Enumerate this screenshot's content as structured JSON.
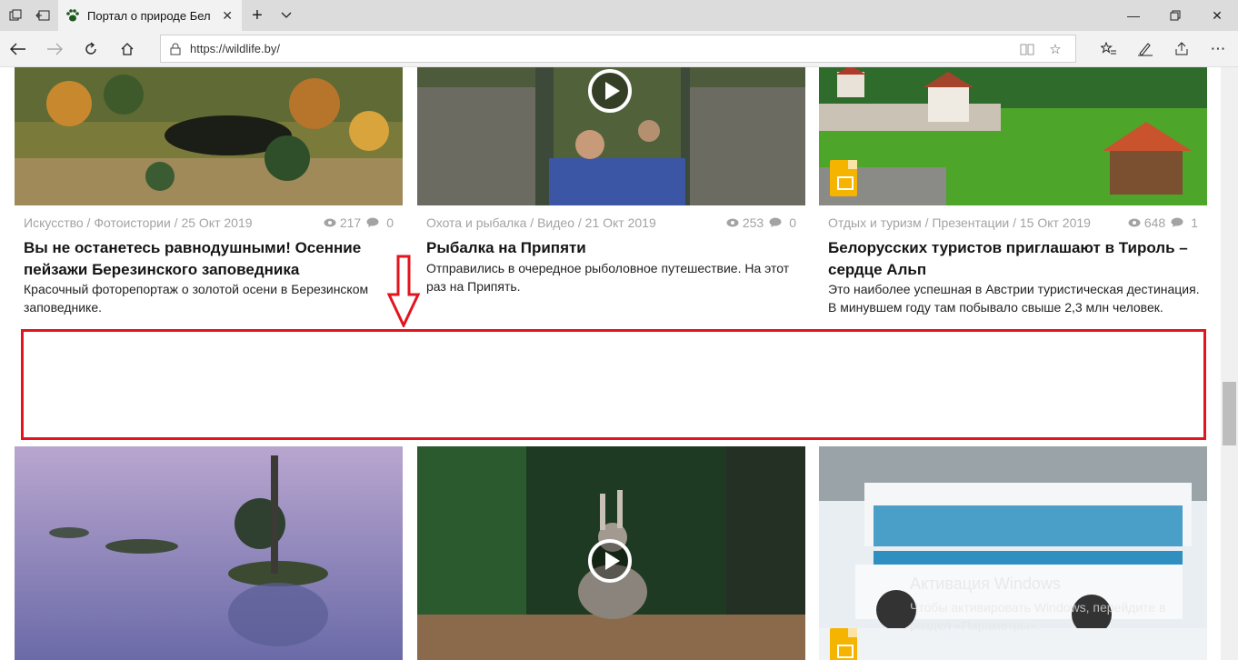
{
  "browser": {
    "tab_title": "Портал о природе Бел",
    "url": "https://wildlife.by/",
    "favicon": "paw-icon"
  },
  "cards_top": [
    {
      "category": "Искусство / Фотоистории / 25 Окт 2019",
      "views": "217",
      "comments": "0",
      "title": "Вы не останетесь равнодушными! Осенние пейзажи Березинского заповедника",
      "description": "Красочный фоторепортаж о золотой осени в Березинском заповеднике.",
      "badge": "none"
    },
    {
      "category": "Охота и рыбалка / Видео / 21 Окт 2019",
      "views": "253",
      "comments": "0",
      "title": "Рыбалка на Припяти",
      "description": "Отправились в очередное рыболовное путешествие. На этот раз на Припять.",
      "badge": "play-icon"
    },
    {
      "category": "Отдых и туризм / Презентации / 15 Окт 2019",
      "views": "648",
      "comments": "1",
      "title": "Белорусских туристов приглашают в Тироль – сердце Альп",
      "description": "Это наиболее успешная в Австрии туристическая дестинация. В минувшем году там побывало свыше 2,3 млн человек.",
      "badge": "presentation-icon"
    }
  ],
  "cards_bottom": [
    {
      "badge": "none"
    },
    {
      "badge": "play-icon"
    },
    {
      "badge": "presentation-icon"
    }
  ],
  "watermark": {
    "title": "Активация Windows",
    "text": "Чтобы активировать Windows, перейдите в раздел «Параметры»."
  },
  "colors": {
    "annotation_red": "#e3141e",
    "meta_gray": "#a3a3a3",
    "chrome_bg": "#dcdcdc"
  }
}
